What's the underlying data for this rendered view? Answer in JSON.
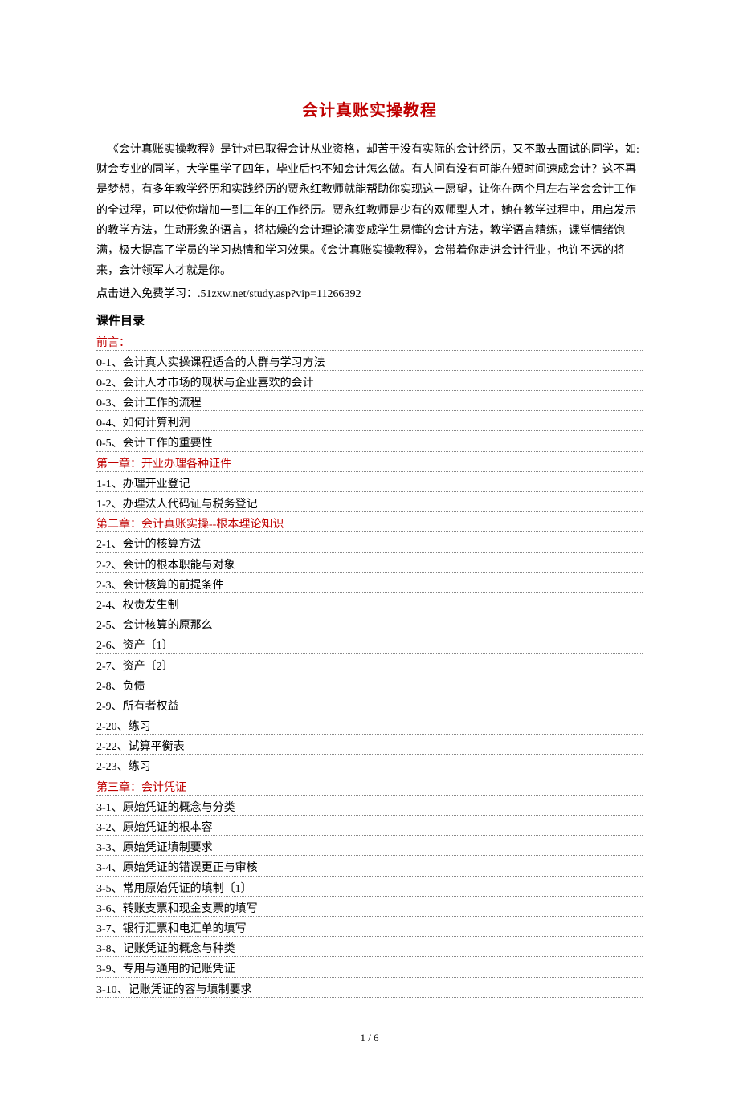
{
  "title": "会计真账实操教程",
  "intro": "《会计真账实操教程》是针对已取得会计从业资格，却苦于没有实际的会计经历，又不敢去面试的同学，如:财会专业的同学，大学里学了四年，毕业后也不知会计怎么做。有人问有没有可能在短时间速成会计？这不再是梦想，有多年教学经历和实践经历的贾永红教师就能帮助你实现这一愿望，让你在两个月左右学会会计工作的全过程，可以使你增加一到二年的工作经历。贾永红教师是少有的双师型人才，她在教学过程中，用启发示的教学方法，生动形象的语言，将枯燥的会计理论演变成学生易懂的会计方法，教学语言精练，课堂情绪饱满，极大提高了学员的学习热情和学习效果。《会计真账实操教程》，会带着你走进会计行业，也许不远的将来，会计领军人才就是你。",
  "link_line": "点击进入免费学习：.51zxw.net/study.asp?vip=11266392",
  "toc_header": "课件目录",
  "sections": [
    {
      "heading": "前言：",
      "items": [
        "0-1、会计真人实操课程适合的人群与学习方法",
        "0-2、会计人才市场的现状与企业喜欢的会计",
        "0-3、会计工作的流程",
        "0-4、如何计算利润",
        "0-5、会计工作的重要性"
      ]
    },
    {
      "heading": "第一章：开业办理各种证件",
      "items": [
        "1-1、办理开业登记",
        "1-2、办理法人代码证与税务登记"
      ]
    },
    {
      "heading": "第二章：会计真账实操--根本理论知识",
      "items": [
        "2-1、会计的核算方法",
        "2-2、会计的根本职能与对象",
        "2-3、会计核算的前提条件",
        "2-4、权责发生制",
        "2-5、会计核算的原那么",
        "2-6、资产〔1〕",
        "2-7、资产〔2〕",
        "2-8、负债",
        "2-9、所有者权益",
        "2-20、练习",
        "2-22、试算平衡表",
        "2-23、练习"
      ]
    },
    {
      "heading": "第三章：会计凭证",
      "items": [
        "3-1、原始凭证的概念与分类",
        "3-2、原始凭证的根本容",
        "3-3、原始凭证填制要求",
        "3-4、原始凭证的错误更正与审核",
        "3-5、常用原始凭证的填制〔1〕",
        "3-6、转账支票和现金支票的填写",
        "3-7、银行汇票和电汇单的填写",
        "3-8、记账凭证的概念与种类",
        "3-9、专用与通用的记账凭证",
        "3-10、记账凭证的容与填制要求"
      ]
    }
  ],
  "footer": "1 / 6"
}
